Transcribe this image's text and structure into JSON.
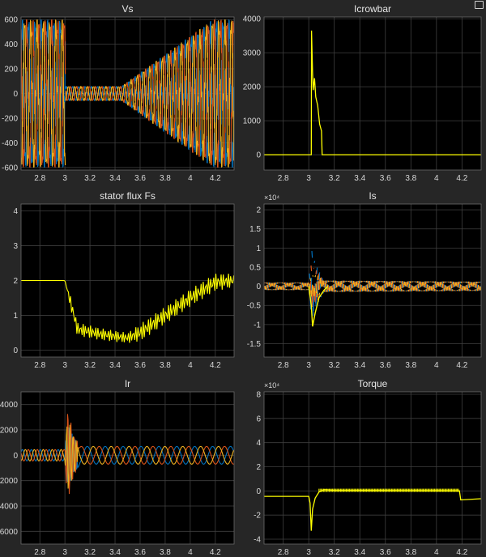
{
  "figure": {
    "background": "#262626",
    "axes_background": "#000000",
    "grid_color": "#3f3f3f",
    "text_color": "#e0e0e0"
  },
  "palette": [
    "#0072BD",
    "#D95319",
    "#EDB120",
    "#4DBEEE"
  ],
  "chart_data": [
    {
      "id": "vs",
      "type": "line",
      "title": "Vs",
      "xlim": [
        2.65,
        4.35
      ],
      "ylim": [
        -620,
        620
      ],
      "xticks": [
        2.8,
        3,
        3.2,
        3.4,
        3.6,
        3.8,
        4,
        4.2
      ],
      "yticks": [
        -600,
        -400,
        -200,
        0,
        200,
        400,
        600
      ],
      "ytick_labels": [
        "-600",
        "-400",
        "-200",
        "0",
        "200",
        "400",
        "600"
      ],
      "grid": true,
      "series": [
        {
          "color": "#0072BD",
          "envelope": [
            [
              2.65,
              600
            ],
            [
              3.0,
              600
            ],
            [
              3.005,
              60
            ],
            [
              3.45,
              60
            ],
            [
              3.6,
              170
            ],
            [
              4.18,
              600
            ],
            [
              4.35,
              600
            ]
          ]
        },
        {
          "color": "#D95319",
          "envelope": [
            [
              2.65,
              600
            ],
            [
              3.0,
              600
            ],
            [
              3.005,
              60
            ],
            [
              3.45,
              60
            ],
            [
              3.6,
              170
            ],
            [
              4.18,
              600
            ],
            [
              4.35,
              600
            ]
          ]
        },
        {
          "color": "#EDB120",
          "envelope": [
            [
              2.65,
              600
            ],
            [
              3.0,
              600
            ],
            [
              3.005,
              60
            ],
            [
              3.45,
              60
            ],
            [
              3.6,
              170
            ],
            [
              4.18,
              600
            ],
            [
              4.35,
              600
            ]
          ]
        }
      ]
    },
    {
      "id": "icrowbar",
      "type": "line",
      "title": "Icrowbar",
      "xlim": [
        2.65,
        4.35
      ],
      "ylim": [
        -450,
        4050
      ],
      "xticks": [
        2.8,
        3,
        3.2,
        3.4,
        3.6,
        3.8,
        4,
        4.2
      ],
      "yticks": [
        0,
        1000,
        2000,
        3000,
        4000
      ],
      "ytick_labels": [
        "0",
        "1000",
        "2000",
        "3000",
        "4000"
      ],
      "grid": true,
      "series": [
        {
          "color": "#FFFF00",
          "points": [
            [
              2.65,
              0
            ],
            [
              3.02,
              0
            ],
            [
              3.022,
              3650
            ],
            [
              3.03,
              2400
            ],
            [
              3.035,
              1900
            ],
            [
              3.045,
              2250
            ],
            [
              3.055,
              1700
            ],
            [
              3.07,
              1450
            ],
            [
              3.085,
              900
            ],
            [
              3.1,
              700
            ],
            [
              3.105,
              0
            ],
            [
              4.35,
              0
            ]
          ]
        }
      ]
    },
    {
      "id": "stator-flux",
      "type": "line",
      "title": "stator flux Fs",
      "xlim": [
        2.65,
        4.35
      ],
      "ylim": [
        -0.2,
        4.2
      ],
      "xticks": [
        2.8,
        3,
        3.2,
        3.4,
        3.6,
        3.8,
        4,
        4.2
      ],
      "yticks": [
        0,
        1,
        2,
        3,
        4
      ],
      "ytick_labels": [
        "0",
        "1",
        "2",
        "3",
        "4"
      ],
      "grid": true,
      "series": [
        {
          "color": "#FFFF00",
          "center": [
            [
              2.65,
              2.0
            ],
            [
              3.0,
              2.0
            ],
            [
              3.1,
              0.6
            ],
            [
              3.3,
              0.45
            ],
            [
              3.5,
              0.35
            ],
            [
              3.6,
              0.5
            ],
            [
              4.0,
              1.5
            ],
            [
              4.2,
              1.95
            ],
            [
              4.35,
              2.0
            ]
          ],
          "ripple": [
            [
              2.65,
              0
            ],
            [
              3.0,
              0
            ],
            [
              3.05,
              0.2
            ],
            [
              3.5,
              0.15
            ],
            [
              3.6,
              0.25
            ],
            [
              4.2,
              0.25
            ],
            [
              4.35,
              0.2
            ]
          ]
        }
      ]
    },
    {
      "id": "is",
      "type": "line",
      "title": "Is",
      "exponent": "×10⁴",
      "xlim": [
        2.65,
        4.35
      ],
      "ylim": [
        -1.85,
        2.15
      ],
      "xticks": [
        2.8,
        3,
        3.2,
        3.4,
        3.6,
        3.8,
        4,
        4.2
      ],
      "yticks": [
        -1.5,
        -1,
        -0.5,
        0,
        0.5,
        1,
        1.5,
        2
      ],
      "ytick_labels": [
        "-1.5",
        "-1",
        "-0.5",
        "0",
        "0.5",
        "1",
        "1.5",
        "2"
      ],
      "grid": true,
      "series": [
        {
          "color": "#0072BD",
          "envelope": [
            [
              2.65,
              0.1
            ],
            [
              3.0,
              0.1
            ],
            [
              3.02,
              1.0
            ],
            [
              3.06,
              0.5
            ],
            [
              3.12,
              0.15
            ],
            [
              4.35,
              0.12
            ]
          ]
        },
        {
          "color": "#D95319",
          "envelope": [
            [
              2.65,
              0.1
            ],
            [
              3.0,
              0.1
            ],
            [
              3.02,
              0.6
            ],
            [
              3.06,
              0.4
            ],
            [
              3.12,
              0.15
            ],
            [
              4.35,
              0.12
            ]
          ]
        },
        {
          "color": "#EDB120",
          "envelope": [
            [
              2.65,
              0.1
            ],
            [
              3.0,
              0.1
            ],
            [
              3.02,
              0.3
            ],
            [
              3.06,
              0.3
            ],
            [
              3.12,
              0.15
            ],
            [
              4.35,
              0.12
            ]
          ]
        }
      ],
      "transient": {
        "color": "#FFFF00",
        "points": [
          [
            3.0,
            0
          ],
          [
            3.02,
            -0.5
          ],
          [
            3.03,
            -1.05
          ],
          [
            3.05,
            -0.7
          ],
          [
            3.08,
            -0.3
          ],
          [
            3.12,
            -0.1
          ],
          [
            3.15,
            0
          ]
        ]
      }
    },
    {
      "id": "ir",
      "type": "line",
      "title": "Ir",
      "xlim": [
        2.65,
        4.35
      ],
      "ylim": [
        -7000,
        5000
      ],
      "xticks": [
        2.8,
        3,
        3.2,
        3.4,
        3.6,
        3.8,
        4,
        4.2
      ],
      "yticks": [
        -6000,
        -4000,
        -2000,
        0,
        2000,
        4000
      ],
      "ytick_labels": [
        "6000",
        "4000",
        "2000",
        "0",
        "2000",
        "4000"
      ],
      "grid": true,
      "series": [
        {
          "color": "#0072BD",
          "phase": 0,
          "envelope": [
            [
              2.65,
              450
            ],
            [
              3.0,
              450
            ],
            [
              3.02,
              2500
            ],
            [
              3.07,
              1500
            ],
            [
              3.12,
              700
            ],
            [
              4.35,
              700
            ]
          ]
        },
        {
          "color": "#D95319",
          "phase": 2.094,
          "envelope": [
            [
              2.65,
              450
            ],
            [
              3.0,
              450
            ],
            [
              3.02,
              3700
            ],
            [
              3.07,
              1700
            ],
            [
              3.12,
              700
            ],
            [
              4.35,
              700
            ]
          ]
        },
        {
          "color": "#EDB120",
          "phase": 4.189,
          "envelope": [
            [
              2.65,
              450
            ],
            [
              3.0,
              450
            ],
            [
              3.02,
              3000
            ],
            [
              3.07,
              1500
            ],
            [
              3.12,
              700
            ],
            [
              4.35,
              700
            ]
          ]
        }
      ]
    },
    {
      "id": "torque",
      "type": "line",
      "title": "Torque",
      "exponent": "×10⁴",
      "xlim": [
        2.65,
        4.35
      ],
      "ylim": [
        -4.4,
        8.2
      ],
      "xticks": [
        2.8,
        3,
        3.2,
        3.4,
        3.6,
        3.8,
        4,
        4.2
      ],
      "yticks": [
        -4,
        -2,
        0,
        2,
        4,
        6,
        8
      ],
      "ytick_labels": [
        "-4",
        "-2",
        "0",
        "2",
        "4",
        "6",
        "8"
      ],
      "grid": true,
      "series": [
        {
          "color": "#FFFF00",
          "points": [
            [
              2.65,
              -0.45
            ],
            [
              3.0,
              -0.45
            ],
            [
              3.01,
              -1.0
            ],
            [
              3.02,
              -3.3
            ],
            [
              3.03,
              -1.5
            ],
            [
              3.05,
              -0.6
            ],
            [
              3.08,
              -0.1
            ],
            [
              3.12,
              0.1
            ],
            [
              3.2,
              0.05
            ],
            [
              4.18,
              0.0
            ],
            [
              4.19,
              -0.75
            ],
            [
              4.35,
              -0.65
            ]
          ]
        }
      ]
    }
  ]
}
